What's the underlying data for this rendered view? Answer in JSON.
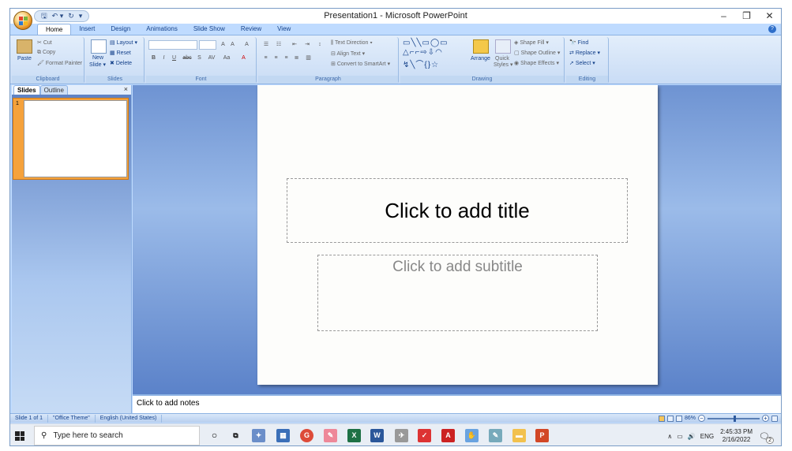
{
  "window": {
    "title": "Presentation1 - Microsoft PowerPoint",
    "minimize": "–",
    "restore": "❐",
    "close": "✕"
  },
  "qat": {
    "save": "🖫",
    "undo": "↶ ▾",
    "redo": "↻",
    "more": "▾"
  },
  "tabs": [
    "Home",
    "Insert",
    "Design",
    "Animations",
    "Slide Show",
    "Review",
    "View"
  ],
  "help": "?",
  "ribbon": {
    "clipboard": {
      "label": "Clipboard",
      "paste": "Paste",
      "cut": "Cut",
      "copy": "Copy",
      "format_painter": "Format Painter"
    },
    "slides": {
      "label": "Slides",
      "new_slide": "New",
      "new_slide2": "Slide ▾",
      "layout": "Layout ▾",
      "reset": "Reset",
      "delete": "Delete"
    },
    "font": {
      "label": "Font",
      "bold": "B",
      "italic": "I",
      "underline": "U",
      "strike": "abc",
      "shadow": "S",
      "spacing": "AV",
      "case": "Aa",
      "grow": "A",
      "shrink": "A",
      "clear": "A"
    },
    "paragraph": {
      "label": "Paragraph",
      "text_direction": "Text Direction ▾",
      "align_text": "Align Text ▾",
      "smartart": "Convert to SmartArt ▾"
    },
    "drawing": {
      "label": "Drawing",
      "arrange": "Arrange",
      "quick_styles": "Quick",
      "quick_styles2": "Styles ▾",
      "shape_fill": "Shape Fill ▾",
      "shape_outline": "Shape Outline ▾",
      "shape_effects": "Shape Effects ▾"
    },
    "editing": {
      "label": "Editing",
      "find": "Find",
      "replace": "Replace ▾",
      "select": "Select ▾"
    }
  },
  "pane": {
    "tab_slides": "Slides",
    "tab_outline": "Outline",
    "close": "×",
    "slide_number": "1"
  },
  "slide": {
    "title_placeholder": "Click to add title",
    "subtitle_placeholder": "Click to add subtitle"
  },
  "notes": {
    "placeholder": "Click to add notes"
  },
  "status": {
    "slide": "Slide 1 of 1",
    "theme": "\"Office Theme\"",
    "language": "English (United States)",
    "zoom": "86%",
    "minus": "−",
    "plus": "+"
  },
  "taskbar": {
    "search_placeholder": "Type here to search",
    "lang": "ENG",
    "time": "2:45:33 PM",
    "date": "2/16/2022",
    "notif_count": "2"
  }
}
